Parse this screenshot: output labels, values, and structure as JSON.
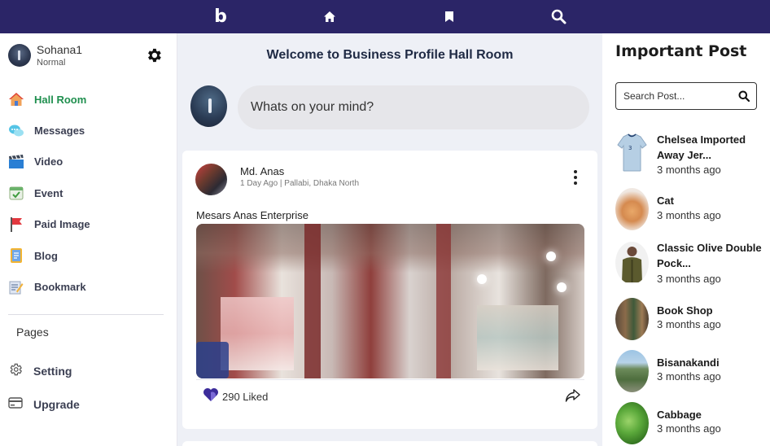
{
  "topbar": {
    "logo": "b",
    "icons": [
      "home-icon",
      "bookmark-icon",
      "search-icon"
    ]
  },
  "user": {
    "name": "Sohana1",
    "role": "Normal"
  },
  "nav": {
    "items": [
      {
        "label": "Hall Room",
        "icon": "house-icon",
        "active": true
      },
      {
        "label": "Messages",
        "icon": "chat-bubbles-icon",
        "active": false
      },
      {
        "label": "Video",
        "icon": "clapperboard-icon",
        "active": false
      },
      {
        "label": "Event",
        "icon": "calendar-icon",
        "active": false
      },
      {
        "label": "Paid Image",
        "icon": "flag-icon",
        "active": false
      },
      {
        "label": "Blog",
        "icon": "notebook-icon",
        "active": false
      },
      {
        "label": "Bookmark",
        "icon": "memo-icon",
        "active": false
      }
    ],
    "pages_title": "Pages",
    "setting_label": "Setting",
    "upgrade_label": "Upgrade"
  },
  "main": {
    "title": "Welcome to Business Profile Hall Room",
    "composer_placeholder": "Whats on your mind?",
    "post": {
      "author": "Md. Anas",
      "meta": "1 Day Ago | Pallabi, Dhaka North",
      "caption": "Mesars Anas Enterprise",
      "likes": "290 Liked"
    }
  },
  "right": {
    "title": "Important Post",
    "search_placeholder": "Search Post...",
    "posts": [
      {
        "name": "Chelsea Imported Away Jer...",
        "time": "3 months ago"
      },
      {
        "name": "Cat",
        "time": "3 months ago"
      },
      {
        "name": "Classic Olive Double Pock...",
        "time": "3 months ago"
      },
      {
        "name": "Book Shop",
        "time": "3 months ago"
      },
      {
        "name": "Bisanakandi",
        "time": "3 months ago"
      },
      {
        "name": "Cabbage",
        "time": "3 months ago"
      }
    ]
  },
  "colors": {
    "topbar": "#2b2567",
    "active_nav": "#1f8f4e",
    "main_bg": "#eef0f6"
  }
}
